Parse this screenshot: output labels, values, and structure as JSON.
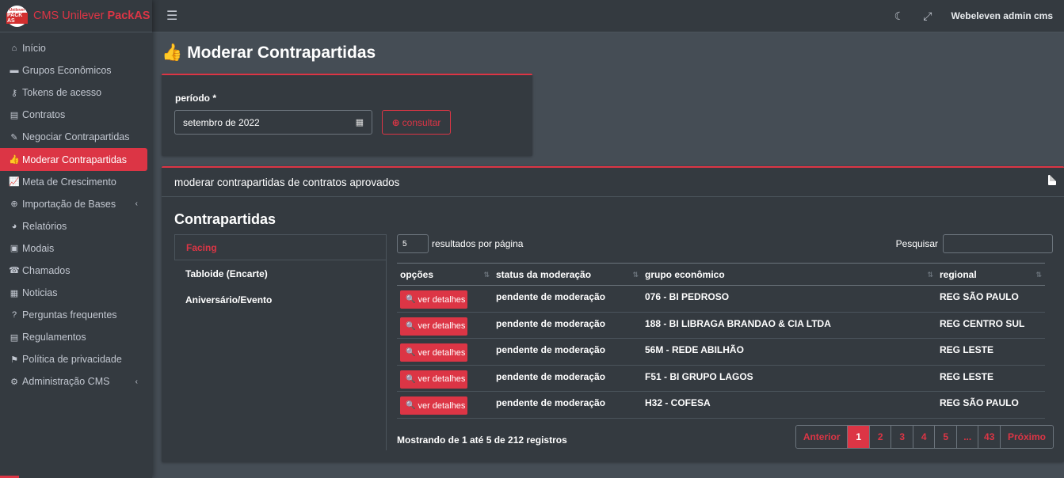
{
  "brand": {
    "logo_line1": "Unilever",
    "logo_line2": "PACK AS",
    "name_light": "CMS Unilever ",
    "name_bold": "PackAS",
    "color": "#dc3545"
  },
  "sidebar": {
    "items": [
      {
        "label": "Início",
        "icon": "home-icon",
        "glyph": "⌂"
      },
      {
        "label": "Grupos Econômicos",
        "icon": "store-icon",
        "glyph": "▬"
      },
      {
        "label": "Tokens de acesso",
        "icon": "key-icon",
        "glyph": "⚷"
      },
      {
        "label": "Contratos",
        "icon": "file-icon",
        "glyph": "▤"
      },
      {
        "label": "Negociar Contrapartidas",
        "icon": "file-signature-icon",
        "glyph": "✎"
      },
      {
        "label": "Moderar Contrapartidas",
        "icon": "thumbs-up-icon",
        "glyph": "👍"
      },
      {
        "label": "Meta de Crescimento",
        "icon": "chart-line-icon",
        "glyph": "📈"
      },
      {
        "label": "Importação de Bases",
        "icon": "arrow-circle-up-icon",
        "glyph": "⊕"
      },
      {
        "label": "Relatórios",
        "icon": "chart-pie-icon",
        "glyph": "◕"
      },
      {
        "label": "Modais",
        "icon": "modal-icon",
        "glyph": "▣"
      },
      {
        "label": "Chamados",
        "icon": "headset-icon",
        "glyph": "☎"
      },
      {
        "label": "Noticias",
        "icon": "newspaper-icon",
        "glyph": "▦"
      },
      {
        "label": "Perguntas frequentes",
        "icon": "question-circle-icon",
        "glyph": "?"
      },
      {
        "label": "Regulamentos",
        "icon": "file-alt-icon",
        "glyph": "▤"
      },
      {
        "label": "Política de privacidade",
        "icon": "bookmark-icon",
        "glyph": "⚑"
      },
      {
        "label": "Administração CMS",
        "icon": "cogs-icon",
        "glyph": "⚙"
      }
    ],
    "caret": "‹"
  },
  "topbar": {
    "menu_icon": "☰",
    "theme_icon": "☾",
    "fullscreen_icon": "⤢",
    "user_name": "Webeleven admin cms"
  },
  "page": {
    "title": "Moderar Contrapartidas",
    "title_icon": "👍"
  },
  "filter": {
    "label": "período *",
    "date_value": "setembro de 2022",
    "button_label": "consultar",
    "button_icon": "⊕"
  },
  "list_card": {
    "header": "moderar contrapartidas de contratos aprovados",
    "section_title": "Contrapartidas",
    "tabs": [
      "Facing",
      "Tabloide (Encarte)",
      "Aniversário/Evento"
    ],
    "length_value": "5",
    "length_text": "resultados por página",
    "search_label": "Pesquisar",
    "columns": [
      "opções",
      "status da moderação",
      "grupo econômico",
      "regional"
    ],
    "sort_icon": "⇅",
    "button_label": "ver detalhes",
    "button_icon": "🔍",
    "rows": [
      {
        "status": "pendente de moderação",
        "grupo": "076 - BI PEDROSO",
        "regional": "REG SÃO PAULO"
      },
      {
        "status": "pendente de moderação",
        "grupo": "188 - BI LIBRAGA BRANDAO & CIA LTDA",
        "regional": "REG CENTRO SUL"
      },
      {
        "status": "pendente de moderação",
        "grupo": "56M - REDE ABILHÃO",
        "regional": "REG LESTE"
      },
      {
        "status": "pendente de moderação",
        "grupo": "F51 - BI GRUPO LAGOS",
        "regional": "REG LESTE"
      },
      {
        "status": "pendente de moderação",
        "grupo": "H32 - COFESA",
        "regional": "REG SÃO PAULO"
      }
    ],
    "info": "Mostrando de 1 até 5 de 212 registros",
    "pagination": {
      "prev": "Anterior",
      "pages": [
        "1",
        "2",
        "3",
        "4",
        "5",
        "...",
        "43"
      ],
      "next": "Próximo",
      "current": "1"
    }
  }
}
